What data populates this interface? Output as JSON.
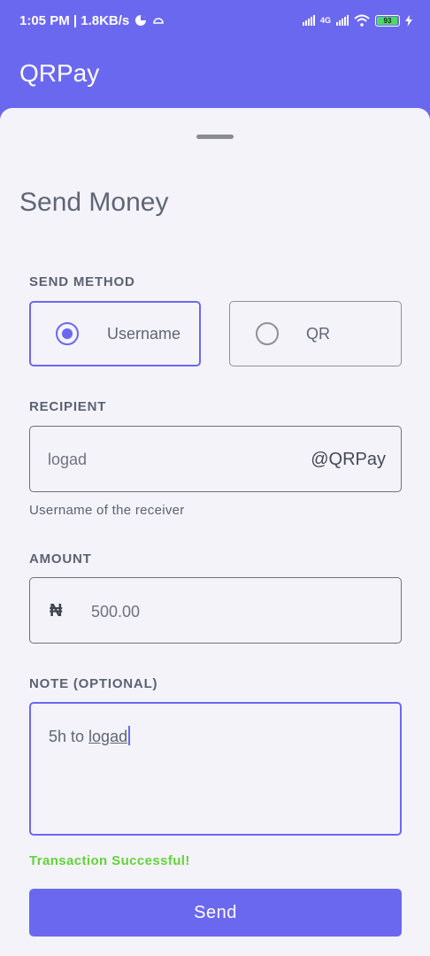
{
  "status_bar": {
    "time_speed": "1:05 PM | 1.8KB/s",
    "network": "4G",
    "battery": "93"
  },
  "app_bar": {
    "title": "QRPay"
  },
  "sheet": {
    "title": "Send Money",
    "send_method": {
      "label": "SEND METHOD",
      "options": [
        {
          "label": "Username",
          "selected": true
        },
        {
          "label": "QR",
          "selected": false
        }
      ]
    },
    "recipient": {
      "label": "RECIPIENT",
      "value": "logad",
      "suffix": "@QRPay",
      "helper": "Username of the receiver"
    },
    "amount": {
      "label": "AMOUNT",
      "currency": "₦",
      "value": "500.00"
    },
    "note": {
      "label": "NOTE (OPTIONAL)",
      "value_prefix": "5h to ",
      "value_underlined": "logad"
    },
    "status_message": "Transaction Successful!",
    "send_button": "Send"
  },
  "colors": {
    "accent": "#6b68f0",
    "success": "#64d23b",
    "sheet_background": "#f4f3f9"
  }
}
